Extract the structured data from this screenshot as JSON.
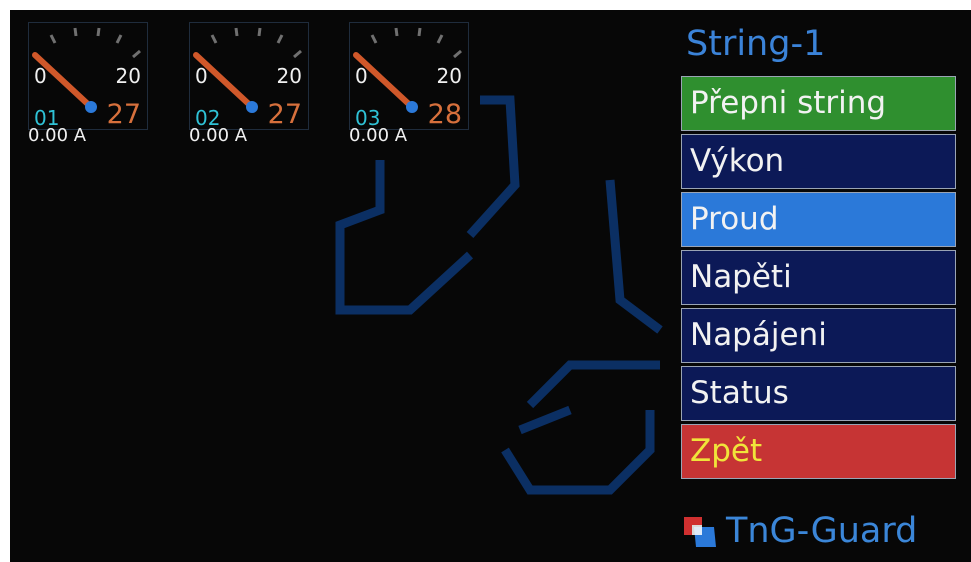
{
  "gauges": [
    {
      "min": "0",
      "max": "20",
      "id": "01",
      "value": "27",
      "current": "0.00 A"
    },
    {
      "min": "0",
      "max": "20",
      "id": "02",
      "value": "27",
      "current": "0.00 A"
    },
    {
      "min": "0",
      "max": "20",
      "id": "03",
      "value": "28",
      "current": "0.00 A"
    }
  ],
  "menu": {
    "title": "String-1",
    "items": [
      {
        "label": "Přepni string",
        "state": "green"
      },
      {
        "label": "Výkon",
        "state": "normal"
      },
      {
        "label": "Proud",
        "state": "selected"
      },
      {
        "label": "Napěti",
        "state": "normal"
      },
      {
        "label": "Napájeni",
        "state": "normal"
      },
      {
        "label": "Status",
        "state": "normal"
      },
      {
        "label": "Zpět",
        "state": "red"
      }
    ]
  },
  "brand": {
    "name": "TnG-Guard"
  },
  "colors": {
    "menu_title": "#3b83d8",
    "item_green": "#2f8f2f",
    "item_selected": "#2b79d9",
    "item_normal": "#0c1957",
    "item_back": "#c63434",
    "needle": "#d0582a",
    "gauge_id": "#2fc2d6",
    "gauge_value": "#d7703c"
  },
  "icons": {
    "brand": "tng-guard-logo-icon",
    "watermark": "tng-logo-watermark"
  }
}
